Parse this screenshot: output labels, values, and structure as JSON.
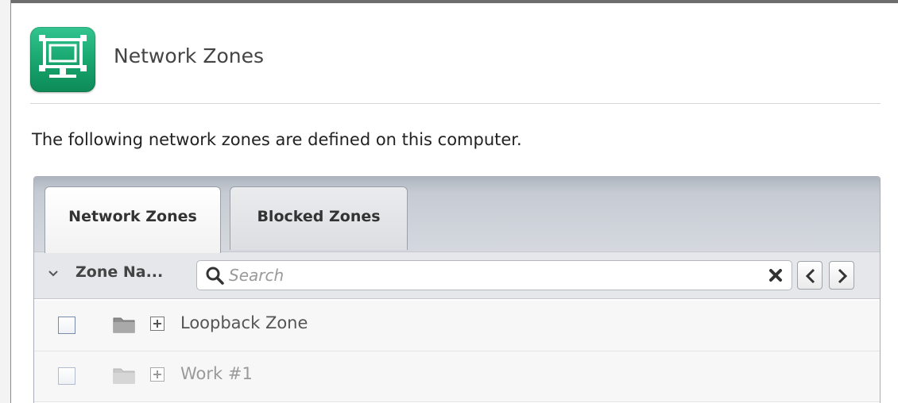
{
  "header": {
    "title": "Network Zones",
    "icon": "network-zones-icon",
    "accent_color": "#19a56f"
  },
  "description": "The following network zones are defined on this computer.",
  "tabs": [
    {
      "label": "Network Zones",
      "active": true
    },
    {
      "label": "Blocked Zones",
      "active": false
    }
  ],
  "toolbar": {
    "column_label": "Zone Na...",
    "sort_icon": "chevron-down-icon",
    "search": {
      "value": "",
      "placeholder": "Search"
    },
    "clear_icon": "close-icon",
    "prev_icon": "chevron-left-icon",
    "next_icon": "chevron-right-icon"
  },
  "rows": [
    {
      "label": "Loopback Zone",
      "checked": false,
      "enabled": true,
      "icon": "folder-icon",
      "expander": "expand-icon"
    },
    {
      "label": "Work #1",
      "checked": false,
      "enabled": false,
      "icon": "folder-icon",
      "expander": "expand-icon"
    }
  ]
}
